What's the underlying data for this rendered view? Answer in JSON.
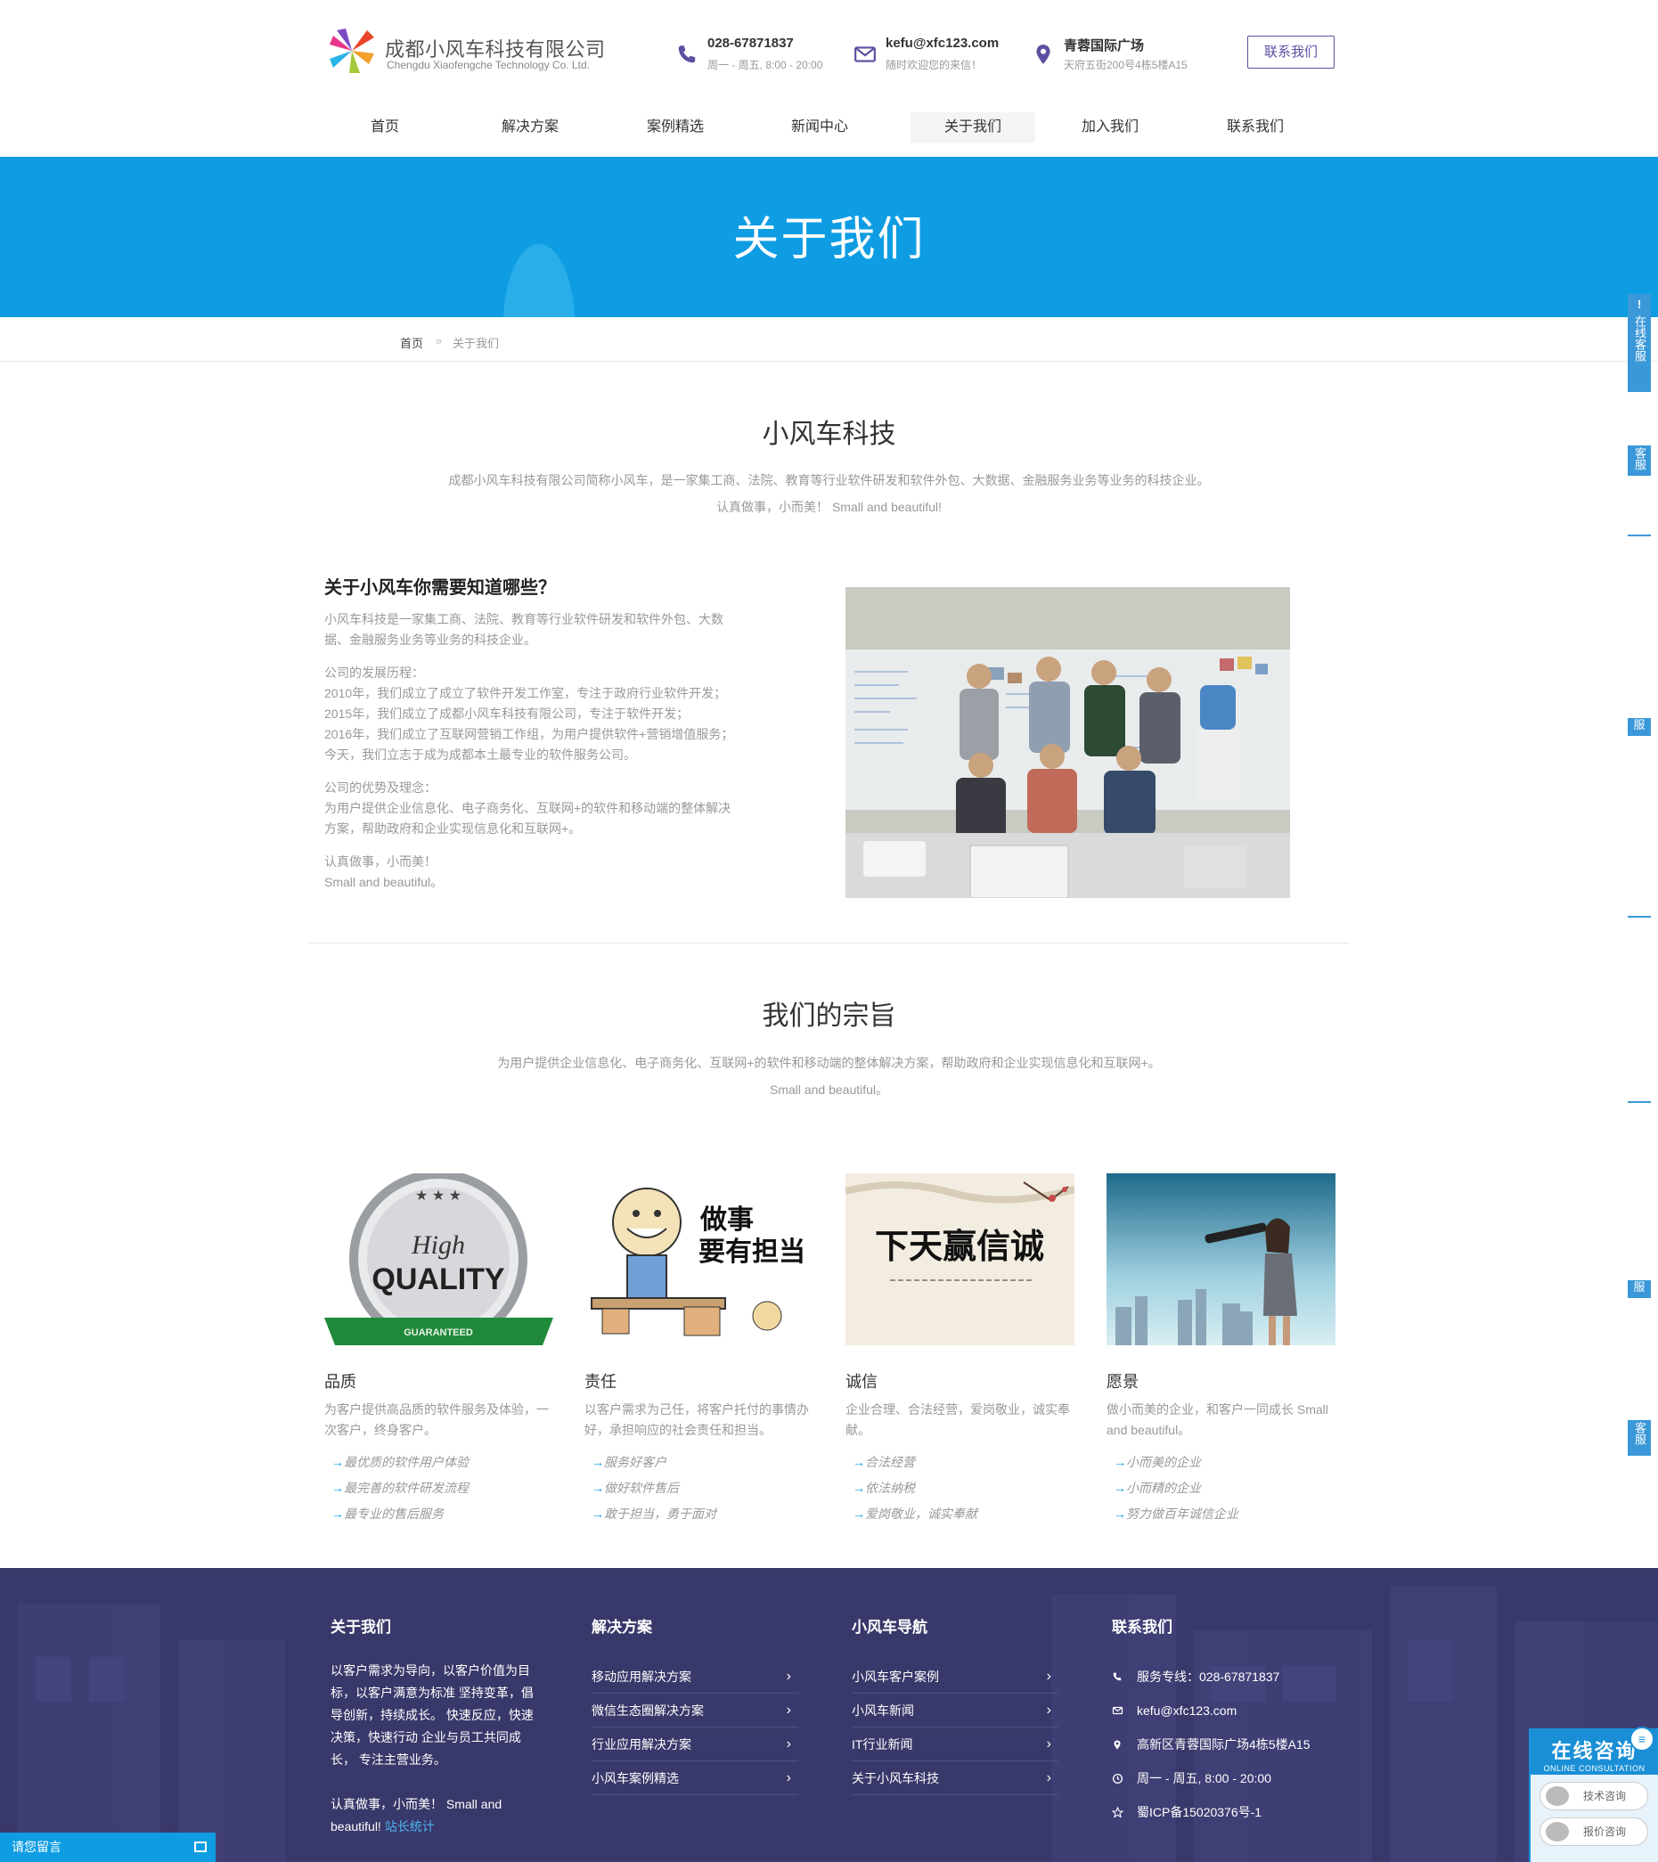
{
  "header": {
    "company_name": "成都小风车科技有限公司",
    "company_name_en": "Chengdu Xiaofengche Technology Co. Ltd.",
    "phone": "028-67871837",
    "phone_hours": "周一 - 周五, 8:00 - 20:00",
    "email": "kefu@xfc123.com",
    "email_note": "随时欢迎您的来信！",
    "address_title": "青蓉国际广场",
    "address_detail": "天府五街200号4栋5楼A15",
    "contact_button": "联系我们"
  },
  "nav": {
    "items": [
      {
        "label": "首页"
      },
      {
        "label": "解决方案"
      },
      {
        "label": "案例精选"
      },
      {
        "label": "新闻中心"
      },
      {
        "label": "关于我们"
      },
      {
        "label": "加入我们"
      },
      {
        "label": "联系我们"
      }
    ],
    "active": "关于我们"
  },
  "banner": {
    "title": "关于我们"
  },
  "breadcrumb": {
    "home": "首页",
    "separator": "»",
    "current": "关于我们"
  },
  "intro": {
    "title": "小风车科技",
    "line1": "成都小风车科技有限公司简称小风车，是一家集工商、法院、教育等行业软件研发和软件外包、大数据、金融服务业务等业务的科技企业。",
    "line2": "认真做事，小而美！ Small and beautiful!"
  },
  "about": {
    "heading": "关于小风车你需要知道哪些？",
    "paragraphs": [
      "小风车科技是一家集工商、法院、教育等行业软件研发和软件外包、大数\n据、金融服务业务等业务的科技企业。",
      "公司的发展历程：\n2010年，我们成立了成立了软件开发工作室，专注于政府行业软件开发；\n2015年，我们成立了成都小风车科技有限公司，专注于软件开发；\n2016年，我们成立了互联网营销工作组，为用户提供软件+营销增值服务；\n今天，我们立志于成为成都本土最专业的软件服务公司。",
      "公司的优势及理念：\n为用户提供企业信息化、电子商务化、互联网+的软件和移动端的整体解决\n方案，帮助政府和企业实现信息化和互联网+。",
      "认真做事，小而美！\nSmall and beautiful。"
    ]
  },
  "mission": {
    "title": "我们的宗旨",
    "line1": "为用户提供企业信息化、电子商务化、互联网+的软件和移动端的整体解决方案，帮助政府和企业实现信息化和互联网+。",
    "line2": "Small and beautiful。"
  },
  "cards": [
    {
      "badge_top": "High",
      "badge_main": "QUALITY",
      "badge_ribbon": "GUARANTEED",
      "title": "品质",
      "desc": "为客户提供高品质的软件服务及体验，一次客户，终身客户。",
      "bullets": [
        "最优质的软件用户体验",
        "最完善的软件研发流程",
        "最专业的售后服务"
      ]
    },
    {
      "image_text1": "做事",
      "image_text2": "要有担当",
      "title": "责任",
      "desc": "以客户需求为己任，将客户托付的事情办好，承担响应的社会责任和担当。",
      "bullets": [
        "服务好客户",
        "做好软件售后",
        "敢于担当，勇于面对"
      ]
    },
    {
      "image_text": "诚信赢天下",
      "title": "诚信",
      "desc": "企业合理、合法经营，爱岗敬业，诚实奉献。",
      "bullets": [
        "合法经营",
        "依法纳税",
        "爱岗敬业，诚实奉献"
      ]
    },
    {
      "title": "愿景",
      "desc": "做小而美的企业，和客户一同成长 Small and beautiful。",
      "bullets": [
        "小而美的企业",
        "小而精的企业",
        "努力做百年诚信企业"
      ]
    }
  ],
  "footer": {
    "about": {
      "heading": "关于我们",
      "text1": "以客户需求为导向，以客户价值为目标，以客户满意为标准 坚持变革，倡导创新，持续成长。 快速反应，快速决策，快速行动 企业与员工共同成长， 专注主营业务。",
      "text2": "认真做事，小而美！ Small and beautiful!",
      "stat_link": "站长统计"
    },
    "solutions": {
      "heading": "解决方案",
      "links": [
        "移动应用解决方案",
        "微信生态圈解决方案",
        "行业应用解决方案",
        "小风车案例精选"
      ]
    },
    "navigation": {
      "heading": "小风车导航",
      "links": [
        "小风车客户案例",
        "小风车新闻",
        "IT行业新闻",
        "关于小风车科技"
      ]
    },
    "contact": {
      "heading": "联系我们",
      "phone": "服务专线：028-67871837",
      "email": "kefu@xfc123.com",
      "address": "高新区青蓉国际广场4栋5楼A15",
      "hours": "周一 - 周五, 8:00 - 20:00",
      "icp": "蜀ICP备15020376号-1"
    }
  },
  "widgets": {
    "side_tab": "在线客服",
    "side_label_short": "服",
    "side_label_double": "客服",
    "message_bar": "请您留言",
    "consult_title": "在线咨询",
    "consult_sub": "ONLINE CONSULTATION",
    "consult_btn1": "技术咨询",
    "consult_btn2": "报价咨询",
    "consult_icon": "chat-bubble-icon"
  },
  "colors": {
    "brand_blue": "#0e9de3",
    "brand_purple": "#5b4fa0",
    "footer_bg": "#38386a"
  }
}
